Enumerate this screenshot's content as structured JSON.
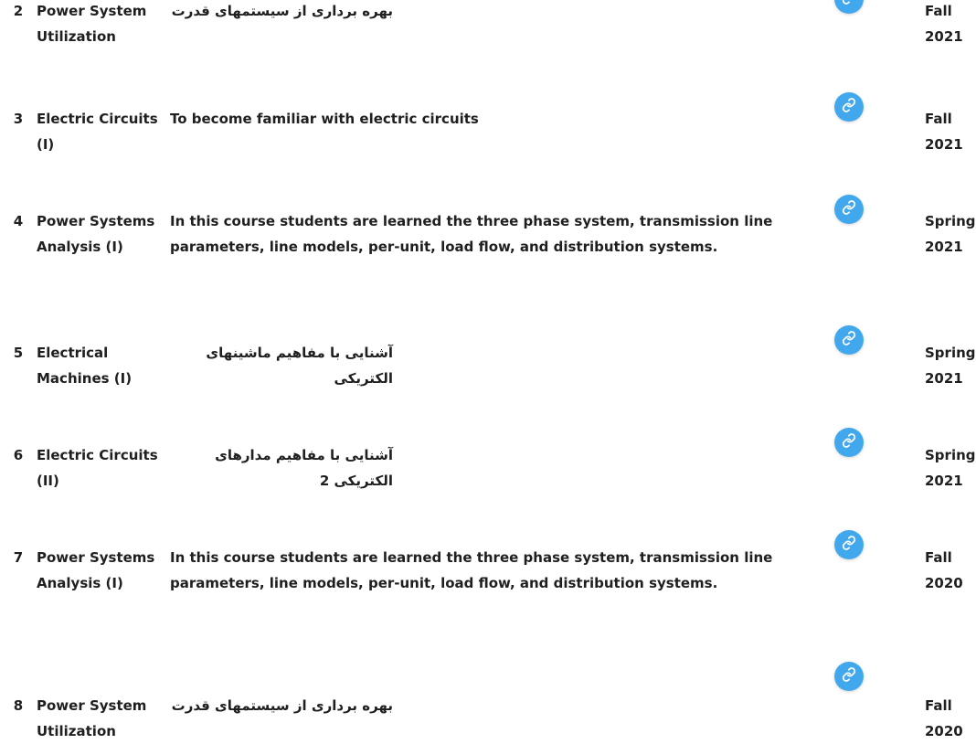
{
  "colors": {
    "text": "#1f1f1f",
    "link_button": "#42a8ee"
  },
  "link_icon": "link-icon",
  "rows": [
    {
      "num": "2",
      "title": "Power System Utilization",
      "desc": "بهره برداری از سیستمهای قدرت",
      "rtl": true,
      "term": "Fall 2021"
    },
    {
      "num": "3",
      "title": "Electric Circuits (I)",
      "desc": "To become familiar with electric circuits",
      "rtl": false,
      "term": "Fall 2021"
    },
    {
      "num": "4",
      "title": "Power Systems Analysis (I)",
      "desc": "In this course students are learned the three phase system, transmission line parameters, line models, per-unit, load flow, and distribution systems.",
      "rtl": false,
      "term": "Spring 2021"
    },
    {
      "num": "5",
      "title": "Electrical Machines (I)",
      "desc": "آشنایی با مفاهیم ماشینهای الکتریکی",
      "rtl": true,
      "term": "Spring 2021"
    },
    {
      "num": "6",
      "title": "Electric Circuits (II)",
      "desc": "آشنایی با مفاهیم مدارهای الکتریکی 2",
      "rtl": true,
      "term": "Spring 2021"
    },
    {
      "num": "7",
      "title": "Power Systems Analysis (I)",
      "desc": "In this course students are learned the three phase system, transmission line parameters, line models, per-unit, load flow, and distribution systems.",
      "rtl": false,
      "term": "Fall 2020"
    },
    {
      "num": "8",
      "title": "Power System Utilization",
      "desc": "بهره برداری از سیستمهای قدرت",
      "rtl": true,
      "term": "Fall 2020"
    }
  ]
}
